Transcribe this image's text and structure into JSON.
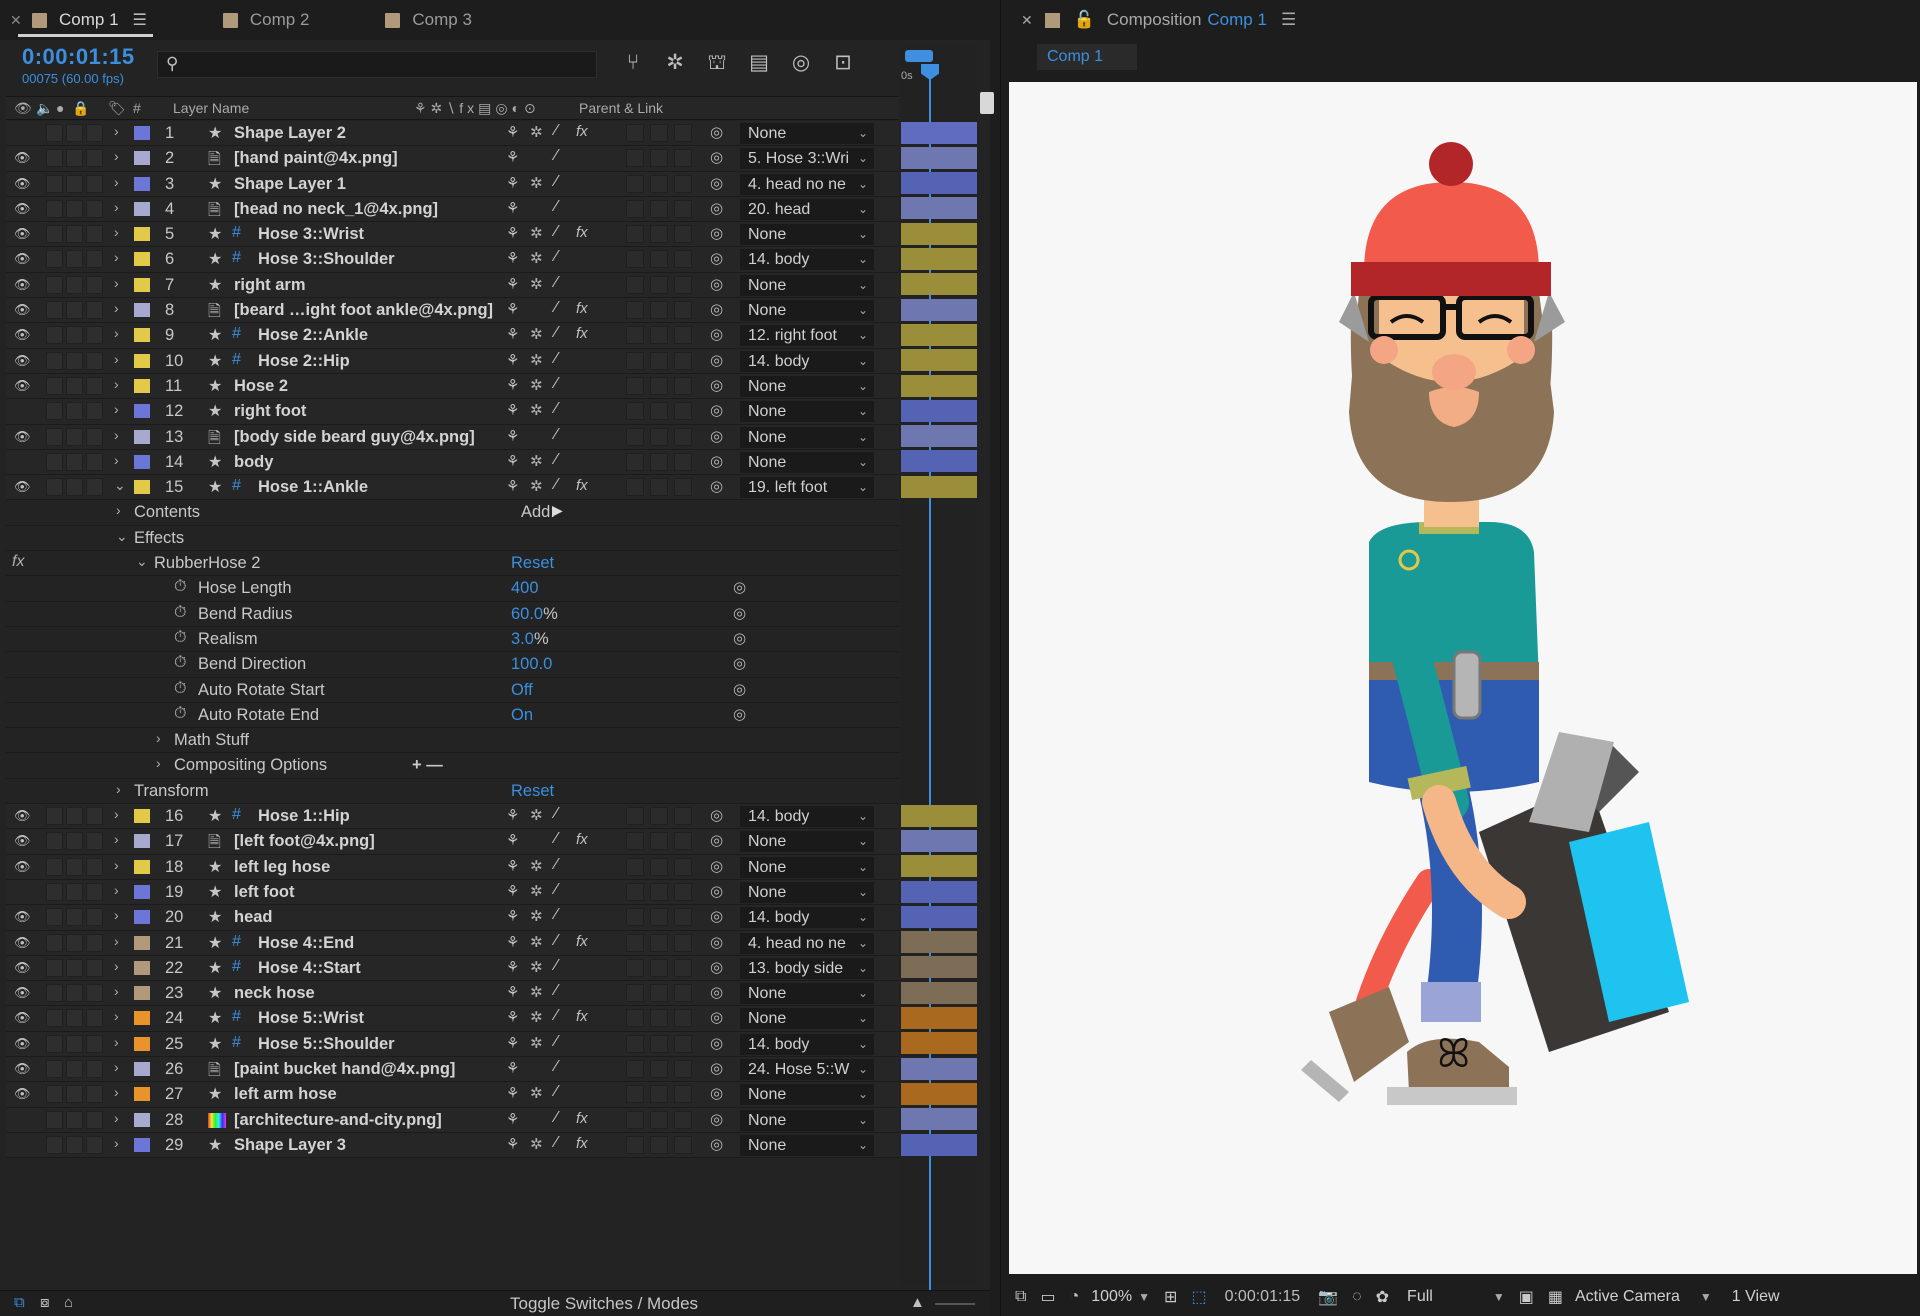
{
  "tabs": [
    {
      "label": "Comp 1",
      "color": "#b09a7b",
      "active": true
    },
    {
      "label": "Comp 2",
      "color": "#b09a7b",
      "active": false
    },
    {
      "label": "Comp 3",
      "color": "#b09a7b",
      "active": false
    }
  ],
  "timecode": "0:00:01:15",
  "frame_info": "00075 (60.00 fps)",
  "search_placeholder": "",
  "columns": {
    "layer_name": "Layer Name",
    "number": "#",
    "parent": "Parent & Link"
  },
  "layers_top": [
    {
      "num": "1",
      "name": "Shape Layer 2",
      "type": "shape",
      "color": "#6b76d6",
      "eye": false,
      "parent": "None",
      "bar": "#5f6cc0"
    },
    {
      "num": "2",
      "name": "[hand paint@4x.png]",
      "type": "file",
      "color": "#a8a9cf",
      "eye": true,
      "parent": "5. Hose 3::Wri",
      "bar": "#6e77b0"
    },
    {
      "num": "3",
      "name": "Shape Layer 1",
      "type": "shape",
      "color": "#6b76d6",
      "eye": true,
      "parent": "4. head no ne",
      "bar": "#5563b5"
    },
    {
      "num": "4",
      "name": "[head no neck_1@4x.png]",
      "type": "file",
      "color": "#a8a9cf",
      "eye": true,
      "parent": "20. head",
      "bar": "#6e77b0"
    },
    {
      "num": "5",
      "name": "Hose 3::Wrist",
      "type": "hose",
      "color": "#e2c94a",
      "eye": true,
      "parent": "None",
      "bar": "#9b8e3a"
    },
    {
      "num": "6",
      "name": "Hose 3::Shoulder",
      "type": "hose",
      "color": "#e2c94a",
      "eye": true,
      "parent": "14. body",
      "bar": "#9b8e3a"
    },
    {
      "num": "7",
      "name": "right arm",
      "type": "shape",
      "color": "#e2c94a",
      "eye": true,
      "parent": "None",
      "bar": "#9b8e3a"
    },
    {
      "num": "8",
      "name": "[beard …ight foot ankle@4x.png]",
      "type": "file",
      "color": "#a8a9cf",
      "eye": true,
      "parent": "None",
      "bar": "#6e77b0"
    },
    {
      "num": "9",
      "name": "Hose 2::Ankle",
      "type": "hose",
      "color": "#e2c94a",
      "eye": true,
      "parent": "12. right foot",
      "bar": "#9b8e3a"
    },
    {
      "num": "10",
      "name": "Hose 2::Hip",
      "type": "hose",
      "color": "#e2c94a",
      "eye": true,
      "parent": "14. body",
      "bar": "#9b8e3a"
    },
    {
      "num": "11",
      "name": "Hose 2",
      "type": "shape",
      "color": "#e2c94a",
      "eye": true,
      "parent": "None",
      "bar": "#9b8e3a"
    },
    {
      "num": "12",
      "name": "right foot",
      "type": "shape",
      "color": "#6b76d6",
      "eye": false,
      "parent": "None",
      "bar": "#5563b5"
    },
    {
      "num": "13",
      "name": "[body side beard guy@4x.png]",
      "type": "file",
      "color": "#a8a9cf",
      "eye": true,
      "parent": "None",
      "bar": "#6e77b0"
    },
    {
      "num": "14",
      "name": "body",
      "type": "shape",
      "color": "#6b76d6",
      "eye": false,
      "parent": "None",
      "bar": "#5563b5"
    },
    {
      "num": "15",
      "name": "Hose 1::Ankle",
      "type": "hose",
      "color": "#e2c94a",
      "eye": true,
      "parent": "19. left foot",
      "bar": "#9b8e3a",
      "expanded": true
    }
  ],
  "expanded": {
    "contents": "Contents",
    "add_label": "Add:",
    "effects": "Effects",
    "effect_name": "RubberHose 2",
    "reset": "Reset",
    "props": [
      {
        "name": "Hose Length",
        "value": "400",
        "unit": ""
      },
      {
        "name": "Bend Radius",
        "value": "60.0",
        "unit": "%"
      },
      {
        "name": "Realism",
        "value": "3.0",
        "unit": "%"
      },
      {
        "name": "Bend Direction",
        "value": "100.0",
        "unit": ""
      },
      {
        "name": "Auto Rotate Start",
        "value": "Off",
        "unit": ""
      },
      {
        "name": "Auto Rotate End",
        "value": "On",
        "unit": ""
      }
    ],
    "math_stuff": "Math Stuff",
    "compositing": "Compositing Options",
    "transform": "Transform",
    "transform_reset": "Reset"
  },
  "layers_bottom": [
    {
      "num": "16",
      "name": "Hose 1::Hip",
      "type": "hose",
      "color": "#e2c94a",
      "eye": true,
      "parent": "14. body",
      "bar": "#9b8e3a"
    },
    {
      "num": "17",
      "name": "[left foot@4x.png]",
      "type": "file",
      "color": "#a8a9cf",
      "eye": true,
      "parent": "None",
      "bar": "#6e77b0"
    },
    {
      "num": "18",
      "name": "left leg hose",
      "type": "shape",
      "color": "#e2c94a",
      "eye": true,
      "parent": "None",
      "bar": "#9b8e3a"
    },
    {
      "num": "19",
      "name": "left foot",
      "type": "shape",
      "color": "#6b76d6",
      "eye": false,
      "parent": "None",
      "bar": "#5563b5"
    },
    {
      "num": "20",
      "name": "head",
      "type": "shape",
      "color": "#6b76d6",
      "eye": true,
      "parent": "14. body",
      "bar": "#5563b5"
    },
    {
      "num": "21",
      "name": "Hose 4::End",
      "type": "hose",
      "color": "#b09a7b",
      "eye": true,
      "parent": "4. head no ne",
      "bar": "#7d6d56"
    },
    {
      "num": "22",
      "name": "Hose 4::Start",
      "type": "hose",
      "color": "#b09a7b",
      "eye": true,
      "parent": "13. body side",
      "bar": "#7d6d56"
    },
    {
      "num": "23",
      "name": "neck hose",
      "type": "shape",
      "color": "#b09a7b",
      "eye": true,
      "parent": "None",
      "bar": "#7d6d56"
    },
    {
      "num": "24",
      "name": "Hose 5::Wrist",
      "type": "hose",
      "color": "#e8932c",
      "eye": true,
      "parent": "None",
      "bar": "#a9691f"
    },
    {
      "num": "25",
      "name": "Hose 5::Shoulder",
      "type": "hose",
      "color": "#e8932c",
      "eye": true,
      "parent": "14. body",
      "bar": "#a9691f"
    },
    {
      "num": "26",
      "name": "[paint bucket hand@4x.png]",
      "type": "file",
      "color": "#a8a9cf",
      "eye": true,
      "parent": "24. Hose 5::W",
      "bar": "#6e77b0"
    },
    {
      "num": "27",
      "name": "left arm hose",
      "type": "shape",
      "color": "#e8932c",
      "eye": true,
      "parent": "None",
      "bar": "#a9691f"
    },
    {
      "num": "28",
      "name": "[architecture-and-city.png]",
      "type": "image",
      "color": "#a8a9cf",
      "eye": false,
      "parent": "None",
      "bar": "#6e77b0"
    },
    {
      "num": "29",
      "name": "Shape Layer 3",
      "type": "shape",
      "color": "#6b76d6",
      "eye": false,
      "parent": "None",
      "bar": "#5563b5"
    }
  ],
  "bottom_bar": {
    "toggle": "Toggle Switches / Modes"
  },
  "right_panel": {
    "title_prefix": "Composition",
    "title_comp": "Comp 1",
    "subtab": "Comp 1",
    "zoom": "100%",
    "time": "0:00:01:15",
    "resolution": "Full",
    "camera": "Active Camera",
    "view": "1 View"
  },
  "accent": "#3b8fde"
}
